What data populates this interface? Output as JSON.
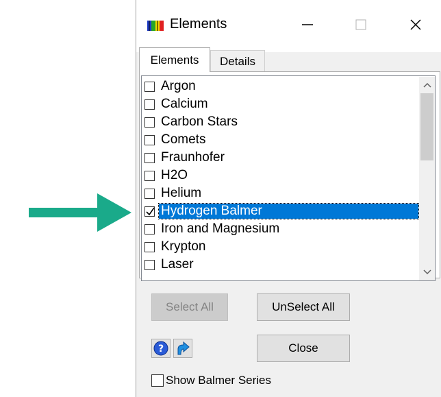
{
  "window": {
    "title": "Elements",
    "controls": [
      "minimize",
      "maximize",
      "close"
    ]
  },
  "tabs": [
    {
      "label": "Elements",
      "active": true
    },
    {
      "label": "Details",
      "active": false
    }
  ],
  "elements_list": {
    "items": [
      {
        "label": "Argon",
        "checked": false,
        "selected": false
      },
      {
        "label": "Calcium",
        "checked": false,
        "selected": false
      },
      {
        "label": "Carbon Stars",
        "checked": false,
        "selected": false
      },
      {
        "label": "Comets",
        "checked": false,
        "selected": false
      },
      {
        "label": "Fraunhofer",
        "checked": false,
        "selected": false
      },
      {
        "label": "H2O",
        "checked": false,
        "selected": false
      },
      {
        "label": "Helium",
        "checked": false,
        "selected": false
      },
      {
        "label": "Hydrogen Balmer",
        "checked": true,
        "selected": true
      },
      {
        "label": "Iron and Magnesium",
        "checked": false,
        "selected": false
      },
      {
        "label": "Krypton",
        "checked": false,
        "selected": false
      },
      {
        "label": "Laser",
        "checked": false,
        "selected": false
      }
    ]
  },
  "buttons": {
    "select_all": "Select All",
    "unselect_all": "UnSelect All",
    "close": "Close"
  },
  "options": {
    "show_balmer_label": "Show Balmer Series",
    "show_balmer_checked": false
  },
  "icons": [
    "spectrum-icon",
    "help-icon",
    "external-link-icon",
    "annotation-arrow-icon"
  ],
  "colors": {
    "selection": "#0078d7",
    "arrow": "#1aaa8a",
    "window_bg": "#f0f0f0"
  }
}
